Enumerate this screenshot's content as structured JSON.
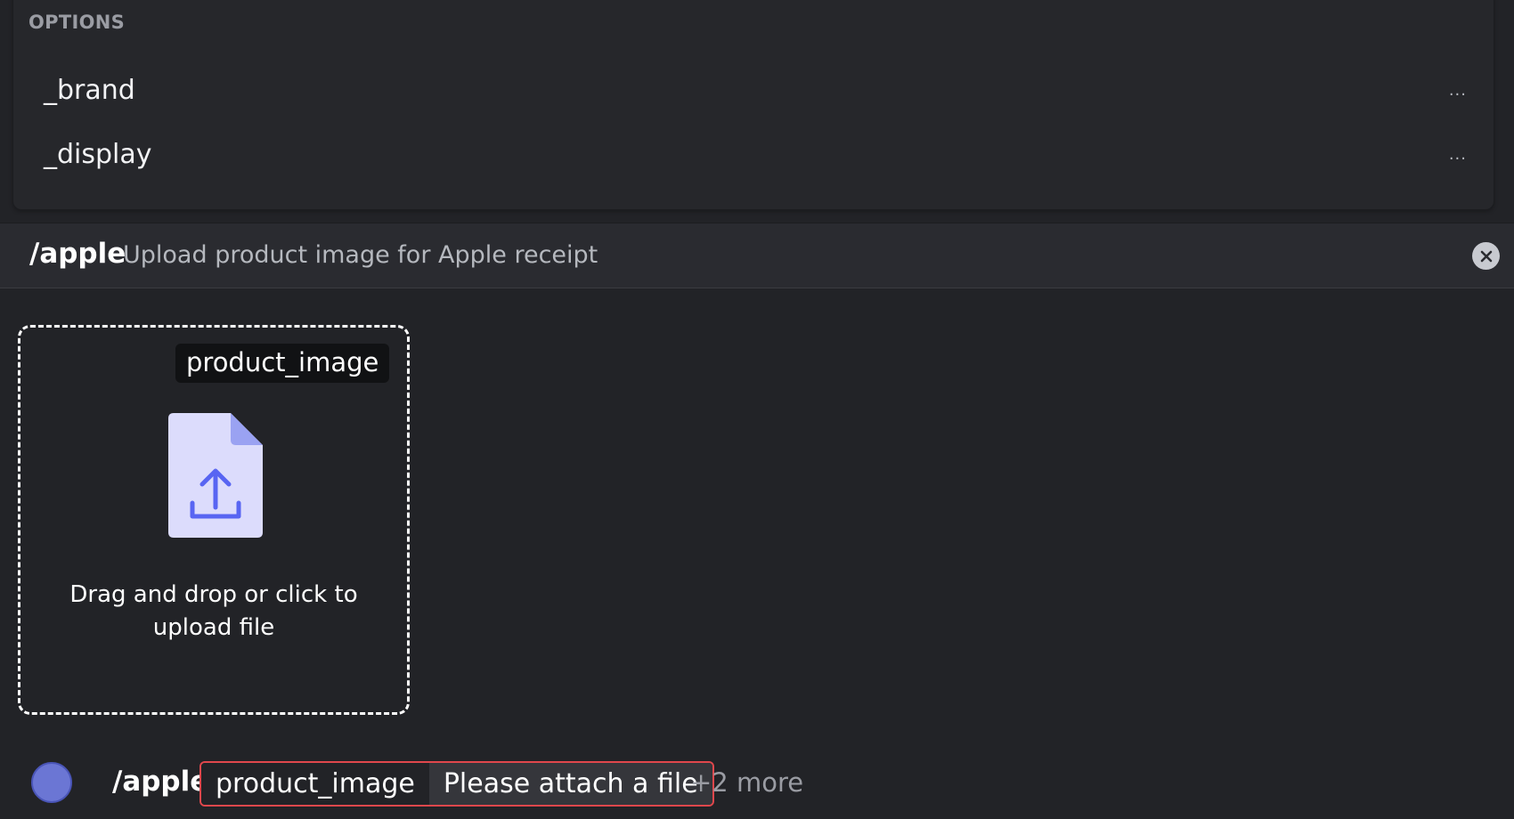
{
  "options": {
    "header": "OPTIONS",
    "items": [
      {
        "label": "_brand",
        "more": "..."
      },
      {
        "label": "_display",
        "more": "..."
      }
    ]
  },
  "command": {
    "name": "/apple",
    "description": "Upload product image for Apple receipt",
    "close_icon": "close-circle-icon"
  },
  "upload": {
    "field_label": "product_image",
    "hint_line1": "Drag and drop or click to",
    "hint_line2": "upload file",
    "icon": "file-upload-icon"
  },
  "composer": {
    "command": "/apple",
    "param_name": "product_image",
    "param_value": "Please attach a file",
    "more": "+2 more"
  },
  "colors": {
    "background": "#222327",
    "panel": "#26272b",
    "accent": "#5865f2",
    "error": "#e0474c"
  }
}
